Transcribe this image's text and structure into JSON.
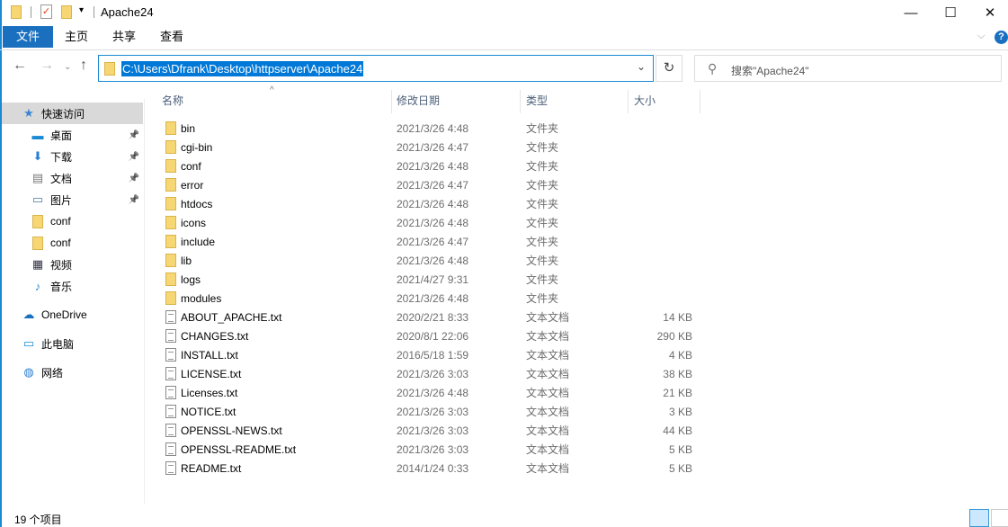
{
  "window": {
    "title": "Apache24"
  },
  "ribbon": {
    "tabs": [
      "文件",
      "主页",
      "共享",
      "查看"
    ]
  },
  "address": {
    "path": "C:\\Users\\Dfrank\\Desktop\\httpserver\\Apache24"
  },
  "search": {
    "placeholder": "搜索\"Apache24\""
  },
  "sidebar": {
    "items": [
      {
        "label": "快速访问",
        "icon": "star-icon",
        "selected": true
      },
      {
        "label": "桌面",
        "icon": "desktop-icon",
        "pinned": true
      },
      {
        "label": "下载",
        "icon": "download-icon",
        "pinned": true
      },
      {
        "label": "文档",
        "icon": "document-icon",
        "pinned": true
      },
      {
        "label": "图片",
        "icon": "pictures-icon",
        "pinned": true
      },
      {
        "label": "conf",
        "icon": "folder-icon"
      },
      {
        "label": "conf",
        "icon": "folder-icon"
      },
      {
        "label": "视频",
        "icon": "video-icon"
      },
      {
        "label": "音乐",
        "icon": "music-icon"
      },
      {
        "label": "OneDrive",
        "icon": "cloud-icon"
      },
      {
        "label": "此电脑",
        "icon": "computer-icon"
      },
      {
        "label": "网络",
        "icon": "network-icon"
      }
    ]
  },
  "columns": {
    "name": "名称",
    "date": "修改日期",
    "type": "类型",
    "size": "大小"
  },
  "files": [
    {
      "name": "bin",
      "date": "2021/3/26 4:48",
      "type": "文件夹",
      "size": "",
      "kind": "dir"
    },
    {
      "name": "cgi-bin",
      "date": "2021/3/26 4:47",
      "type": "文件夹",
      "size": "",
      "kind": "dir"
    },
    {
      "name": "conf",
      "date": "2021/3/26 4:48",
      "type": "文件夹",
      "size": "",
      "kind": "dir"
    },
    {
      "name": "error",
      "date": "2021/3/26 4:47",
      "type": "文件夹",
      "size": "",
      "kind": "dir"
    },
    {
      "name": "htdocs",
      "date": "2021/3/26 4:48",
      "type": "文件夹",
      "size": "",
      "kind": "dir"
    },
    {
      "name": "icons",
      "date": "2021/3/26 4:48",
      "type": "文件夹",
      "size": "",
      "kind": "dir"
    },
    {
      "name": "include",
      "date": "2021/3/26 4:47",
      "type": "文件夹",
      "size": "",
      "kind": "dir"
    },
    {
      "name": "lib",
      "date": "2021/3/26 4:48",
      "type": "文件夹",
      "size": "",
      "kind": "dir"
    },
    {
      "name": "logs",
      "date": "2021/4/27 9:31",
      "type": "文件夹",
      "size": "",
      "kind": "dir"
    },
    {
      "name": "modules",
      "date": "2021/3/26 4:48",
      "type": "文件夹",
      "size": "",
      "kind": "dir"
    },
    {
      "name": "ABOUT_APACHE.txt",
      "date": "2020/2/21 8:33",
      "type": "文本文档",
      "size": "14 KB",
      "kind": "txt"
    },
    {
      "name": "CHANGES.txt",
      "date": "2020/8/1 22:06",
      "type": "文本文档",
      "size": "290 KB",
      "kind": "txt"
    },
    {
      "name": "INSTALL.txt",
      "date": "2016/5/18 1:59",
      "type": "文本文档",
      "size": "4 KB",
      "kind": "txt"
    },
    {
      "name": "LICENSE.txt",
      "date": "2021/3/26 3:03",
      "type": "文本文档",
      "size": "38 KB",
      "kind": "txt"
    },
    {
      "name": "Licenses.txt",
      "date": "2021/3/26 4:48",
      "type": "文本文档",
      "size": "21 KB",
      "kind": "txt"
    },
    {
      "name": "NOTICE.txt",
      "date": "2021/3/26 3:03",
      "type": "文本文档",
      "size": "3 KB",
      "kind": "txt"
    },
    {
      "name": "OPENSSL-NEWS.txt",
      "date": "2021/3/26 3:03",
      "type": "文本文档",
      "size": "44 KB",
      "kind": "txt"
    },
    {
      "name": "OPENSSL-README.txt",
      "date": "2021/3/26 3:03",
      "type": "文本文档",
      "size": "5 KB",
      "kind": "txt"
    },
    {
      "name": "README.txt",
      "date": "2014/1/24 0:33",
      "type": "文本文档",
      "size": "5 KB",
      "kind": "txt"
    }
  ],
  "status": {
    "count": "19 个项目"
  }
}
